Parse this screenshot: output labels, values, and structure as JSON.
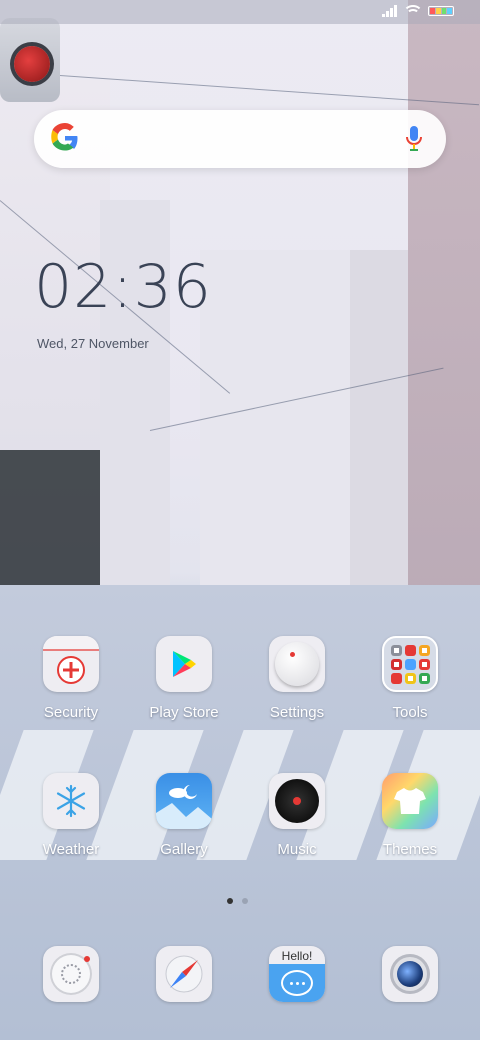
{
  "status_bar": {
    "icons": [
      "signal-icon",
      "wifi-icon",
      "battery-icon"
    ]
  },
  "search": {
    "google_logo": "google-logo-icon",
    "mic_icon": "mic-icon"
  },
  "clock": {
    "time": "02:36",
    "date": "Wed, 27 November"
  },
  "apps_row1": [
    {
      "label": "Security",
      "icon": "security-icon"
    },
    {
      "label": "Play Store",
      "icon": "play-store-icon"
    },
    {
      "label": "Settings",
      "icon": "settings-icon"
    },
    {
      "label": "Tools",
      "icon": "tools-folder-icon"
    }
  ],
  "apps_row2": [
    {
      "label": "Weather",
      "icon": "snowflake-icon"
    },
    {
      "label": "Gallery",
      "icon": "gallery-icon"
    },
    {
      "label": "Music",
      "icon": "music-icon"
    },
    {
      "label": "Themes",
      "icon": "themes-icon"
    }
  ],
  "page_indicator": {
    "pages": 2,
    "current": 1
  },
  "dock": {
    "phone_icon": "phone-dial-icon",
    "browser_icon": "compass-icon",
    "messages_icon": "messages-icon",
    "messages_badge_text": "Hello!",
    "camera_icon": "camera-icon"
  },
  "colors": {
    "accent_red": "#e53935",
    "clock_text": "#3a4356"
  }
}
